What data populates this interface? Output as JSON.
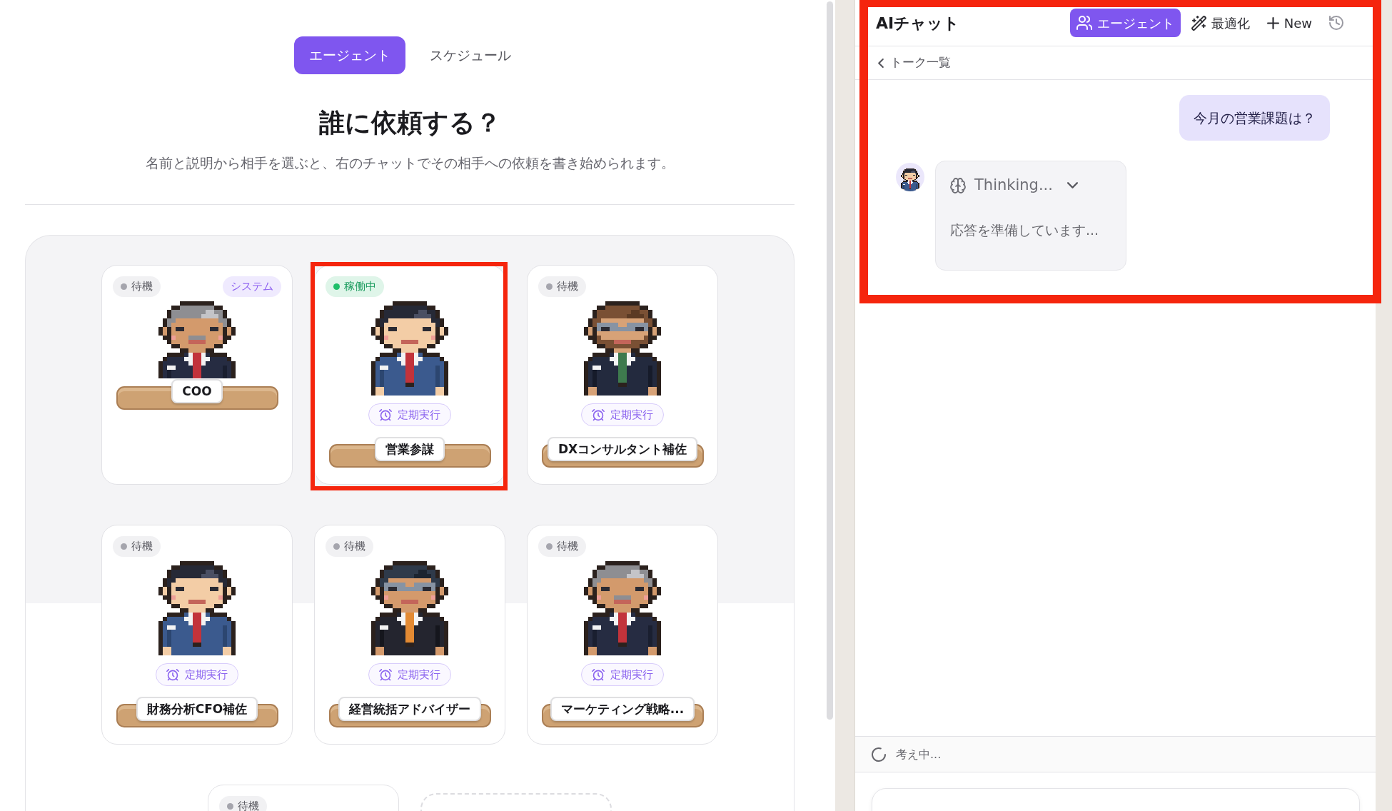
{
  "tabs": [
    {
      "label": "エージェント",
      "selected": true
    },
    {
      "label": "スケジュール",
      "selected": false
    }
  ],
  "heading": "誰に依頼する？",
  "description": "名前と説明から相手を選ぶと、右のチャットでその相手への依頼を書き始められます。",
  "agents": [
    {
      "kind": "agent",
      "name": "COO",
      "status": {
        "label": "待機",
        "active": false
      },
      "badge": "システム",
      "highlighted": false
    },
    {
      "kind": "agent",
      "name": "営業参謀",
      "status": {
        "label": "稼働中",
        "active": true
      },
      "schedule": "定期実行",
      "highlighted": true
    },
    {
      "kind": "agent",
      "name": "DXコンサルタント補佐",
      "status": {
        "label": "待機",
        "active": false
      },
      "schedule": "定期実行",
      "highlighted": false
    },
    {
      "kind": "agent",
      "name": "財務分析CFO補佐",
      "status": {
        "label": "待機",
        "active": false
      },
      "schedule": "定期実行",
      "highlighted": false
    },
    {
      "kind": "agent",
      "name": "経営統括アドバイザー",
      "status": {
        "label": "待機",
        "active": false
      },
      "schedule": "定期実行",
      "highlighted": false
    },
    {
      "kind": "agent",
      "name": "マーケティング戦略...",
      "status": {
        "label": "待機",
        "active": false
      },
      "schedule": "定期実行",
      "highlighted": false
    },
    {
      "kind": "agent",
      "status": {
        "label": "待機",
        "active": false
      },
      "highlighted": false
    },
    {
      "kind": "empty_slot"
    }
  ],
  "chat": {
    "title": "AIチャット",
    "highlighted": true,
    "toolbar": [
      {
        "kind": "agents",
        "label": "エージェント",
        "selected": true
      },
      {
        "kind": "optimize",
        "label": "最適化",
        "selected": false
      },
      {
        "kind": "new",
        "label": "New",
        "selected": false
      },
      {
        "kind": "history",
        "selected": false
      }
    ],
    "back_link": "トーク一覧",
    "messages": [
      {
        "kind": "user",
        "text": "今月の営業課題は？"
      },
      {
        "kind": "thinking",
        "title": "Thinking...",
        "text": "応答を準備しています..."
      }
    ],
    "status": "考え中..."
  }
}
